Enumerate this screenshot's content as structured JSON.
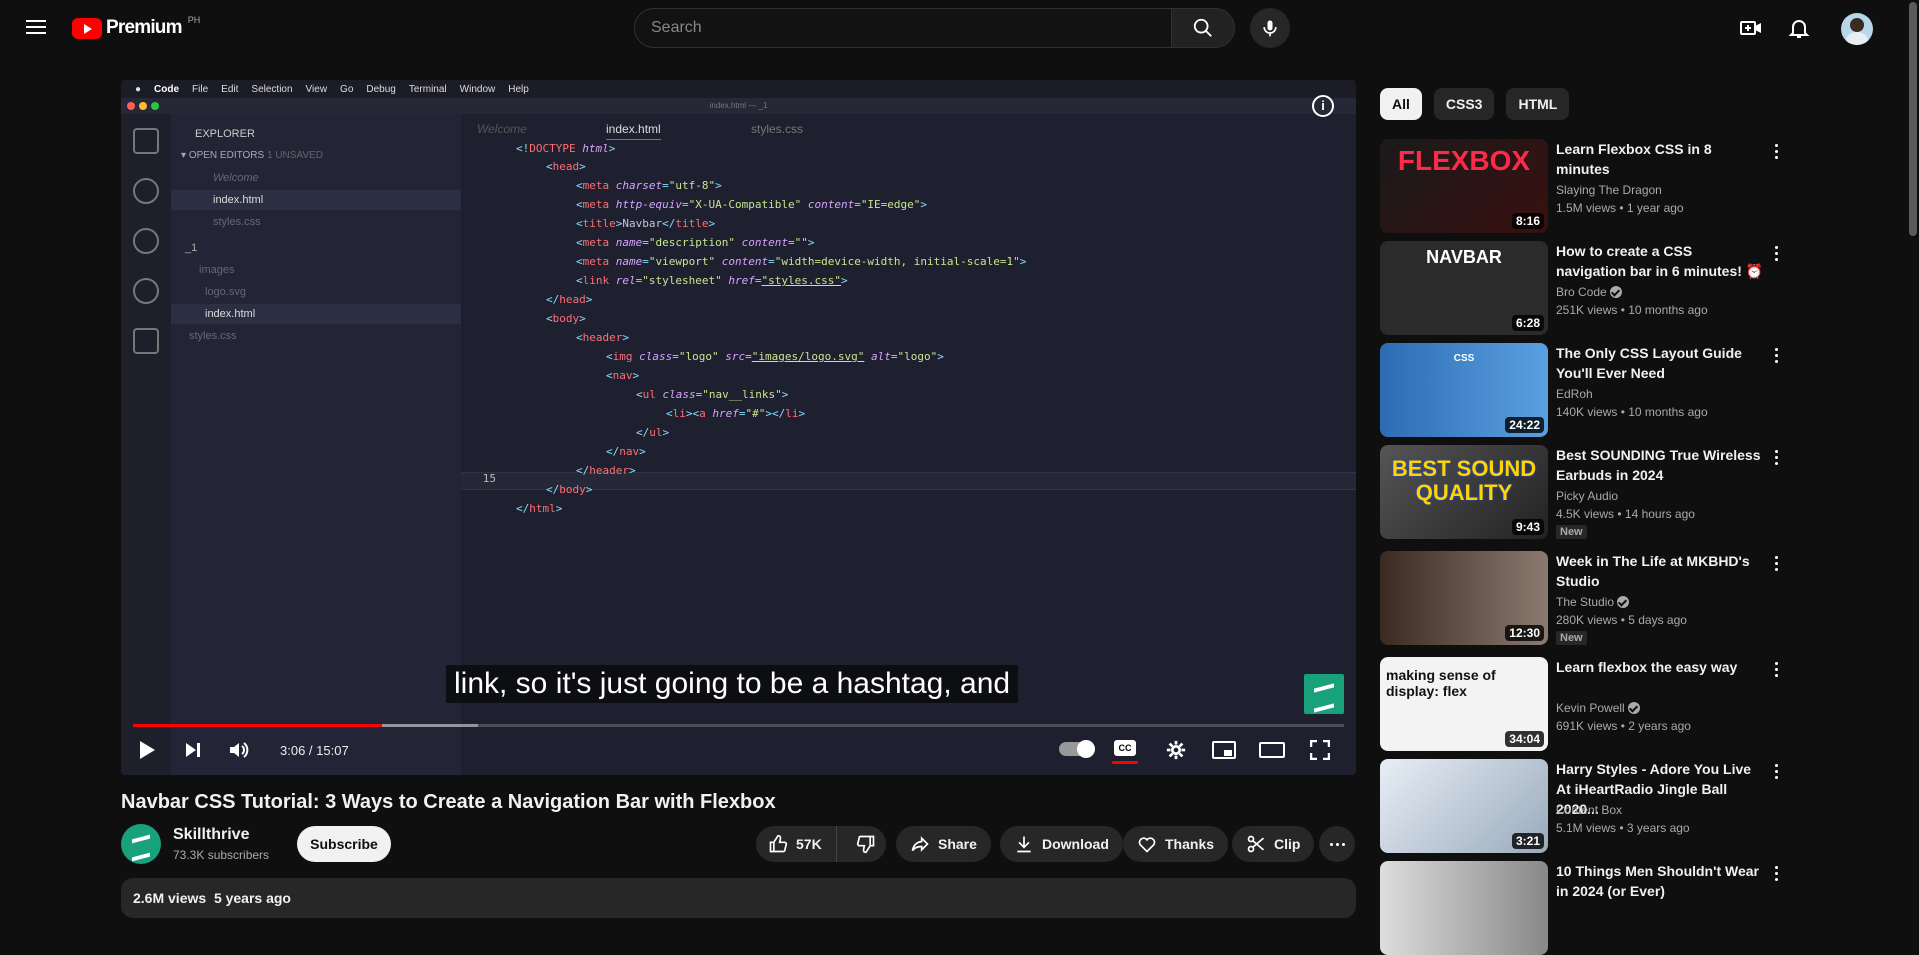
{
  "header": {
    "logo_text": "Premium",
    "country": "PH",
    "search_placeholder": "Search"
  },
  "player": {
    "subtitle": "link, so it's just going to be a hashtag, and",
    "time": "3:06 / 15:07",
    "progress_played_fraction": 0.206,
    "progress_buffered_fraction": 0.285,
    "vscode": {
      "menubar": [
        "Code",
        "File",
        "Edit",
        "Selection",
        "View",
        "Go",
        "Debug",
        "Terminal",
        "Window",
        "Help"
      ],
      "window_title": "index.html — _1",
      "explorer_title": "EXPLORER",
      "open_editors": "OPEN EDITORS",
      "unsaved": "1 UNSAVED",
      "sidebar_files": [
        "Welcome",
        "index.html",
        "styles.css",
        "_1",
        "images",
        "logo.svg",
        "index.html",
        "styles.css"
      ],
      "tabs": [
        "Welcome",
        "index.html",
        "styles.css"
      ],
      "current_line_number": "15"
    }
  },
  "video": {
    "title": "Navbar CSS Tutorial: 3 Ways to Create a Navigation Bar with Flexbox",
    "channel": "Skillthrive",
    "subscribers": "73.3K subscribers",
    "subscribe_label": "Subscribe",
    "likes": "57K",
    "share_label": "Share",
    "download_label": "Download",
    "thanks_label": "Thanks",
    "clip_label": "Clip",
    "views": "2.6M views",
    "age": "5 years ago"
  },
  "chips": [
    "All",
    "CSS3",
    "HTML"
  ],
  "recommendations": [
    {
      "title": "Learn Flexbox CSS in 8 minutes",
      "channel": "Slaying The Dragon",
      "meta": "1.5M views • 1 year ago",
      "duration": "8:16",
      "verified": false,
      "new": false,
      "thumb_text": "FLEXBOX"
    },
    {
      "title": "How to create a CSS navigation bar in 6 minutes! ⏰",
      "channel": "Bro Code",
      "meta": "251K views • 10 months ago",
      "duration": "6:28",
      "verified": true,
      "new": false,
      "thumb_text": "NAVBAR"
    },
    {
      "title": "The Only CSS Layout Guide You'll Ever Need",
      "channel": "EdRoh",
      "meta": "140K views • 10 months ago",
      "duration": "24:22",
      "verified": false,
      "new": false,
      "thumb_text": "CSS"
    },
    {
      "title": "Best SOUNDING True Wireless Earbuds in 2024",
      "channel": "Picky Audio",
      "meta": "4.5K views • 14 hours ago",
      "duration": "9:43",
      "verified": false,
      "new": true,
      "thumb_text": "BEST SOUND QUALITY"
    },
    {
      "title": "Week in The Life at MKBHD's Studio",
      "channel": "The Studio",
      "meta": "280K views • 5 days ago",
      "duration": "12:30",
      "verified": true,
      "new": true,
      "thumb_text": ""
    },
    {
      "title": "Learn flexbox the easy way",
      "channel": "Kevin Powell",
      "meta": "691K views • 2 years ago",
      "duration": "34:04",
      "verified": true,
      "new": false,
      "thumb_text": "making sense of display: flex"
    },
    {
      "title": "Harry Styles - Adore You Live At iHeartRadio Jingle Ball 2020...",
      "channel": "Content Box",
      "meta": "5.1M views • 3 years ago",
      "duration": "3:21",
      "verified": false,
      "new": false,
      "thumb_text": ""
    },
    {
      "title": "10 Things Men Shouldn't Wear in 2024 (or Ever)",
      "channel": "",
      "meta": "",
      "duration": "",
      "verified": false,
      "new": false,
      "thumb_text": ""
    }
  ],
  "new_label": "New",
  "colors": {
    "accent": "#ff0000",
    "background": "#0f0f0f",
    "chip_bg": "#272727"
  }
}
